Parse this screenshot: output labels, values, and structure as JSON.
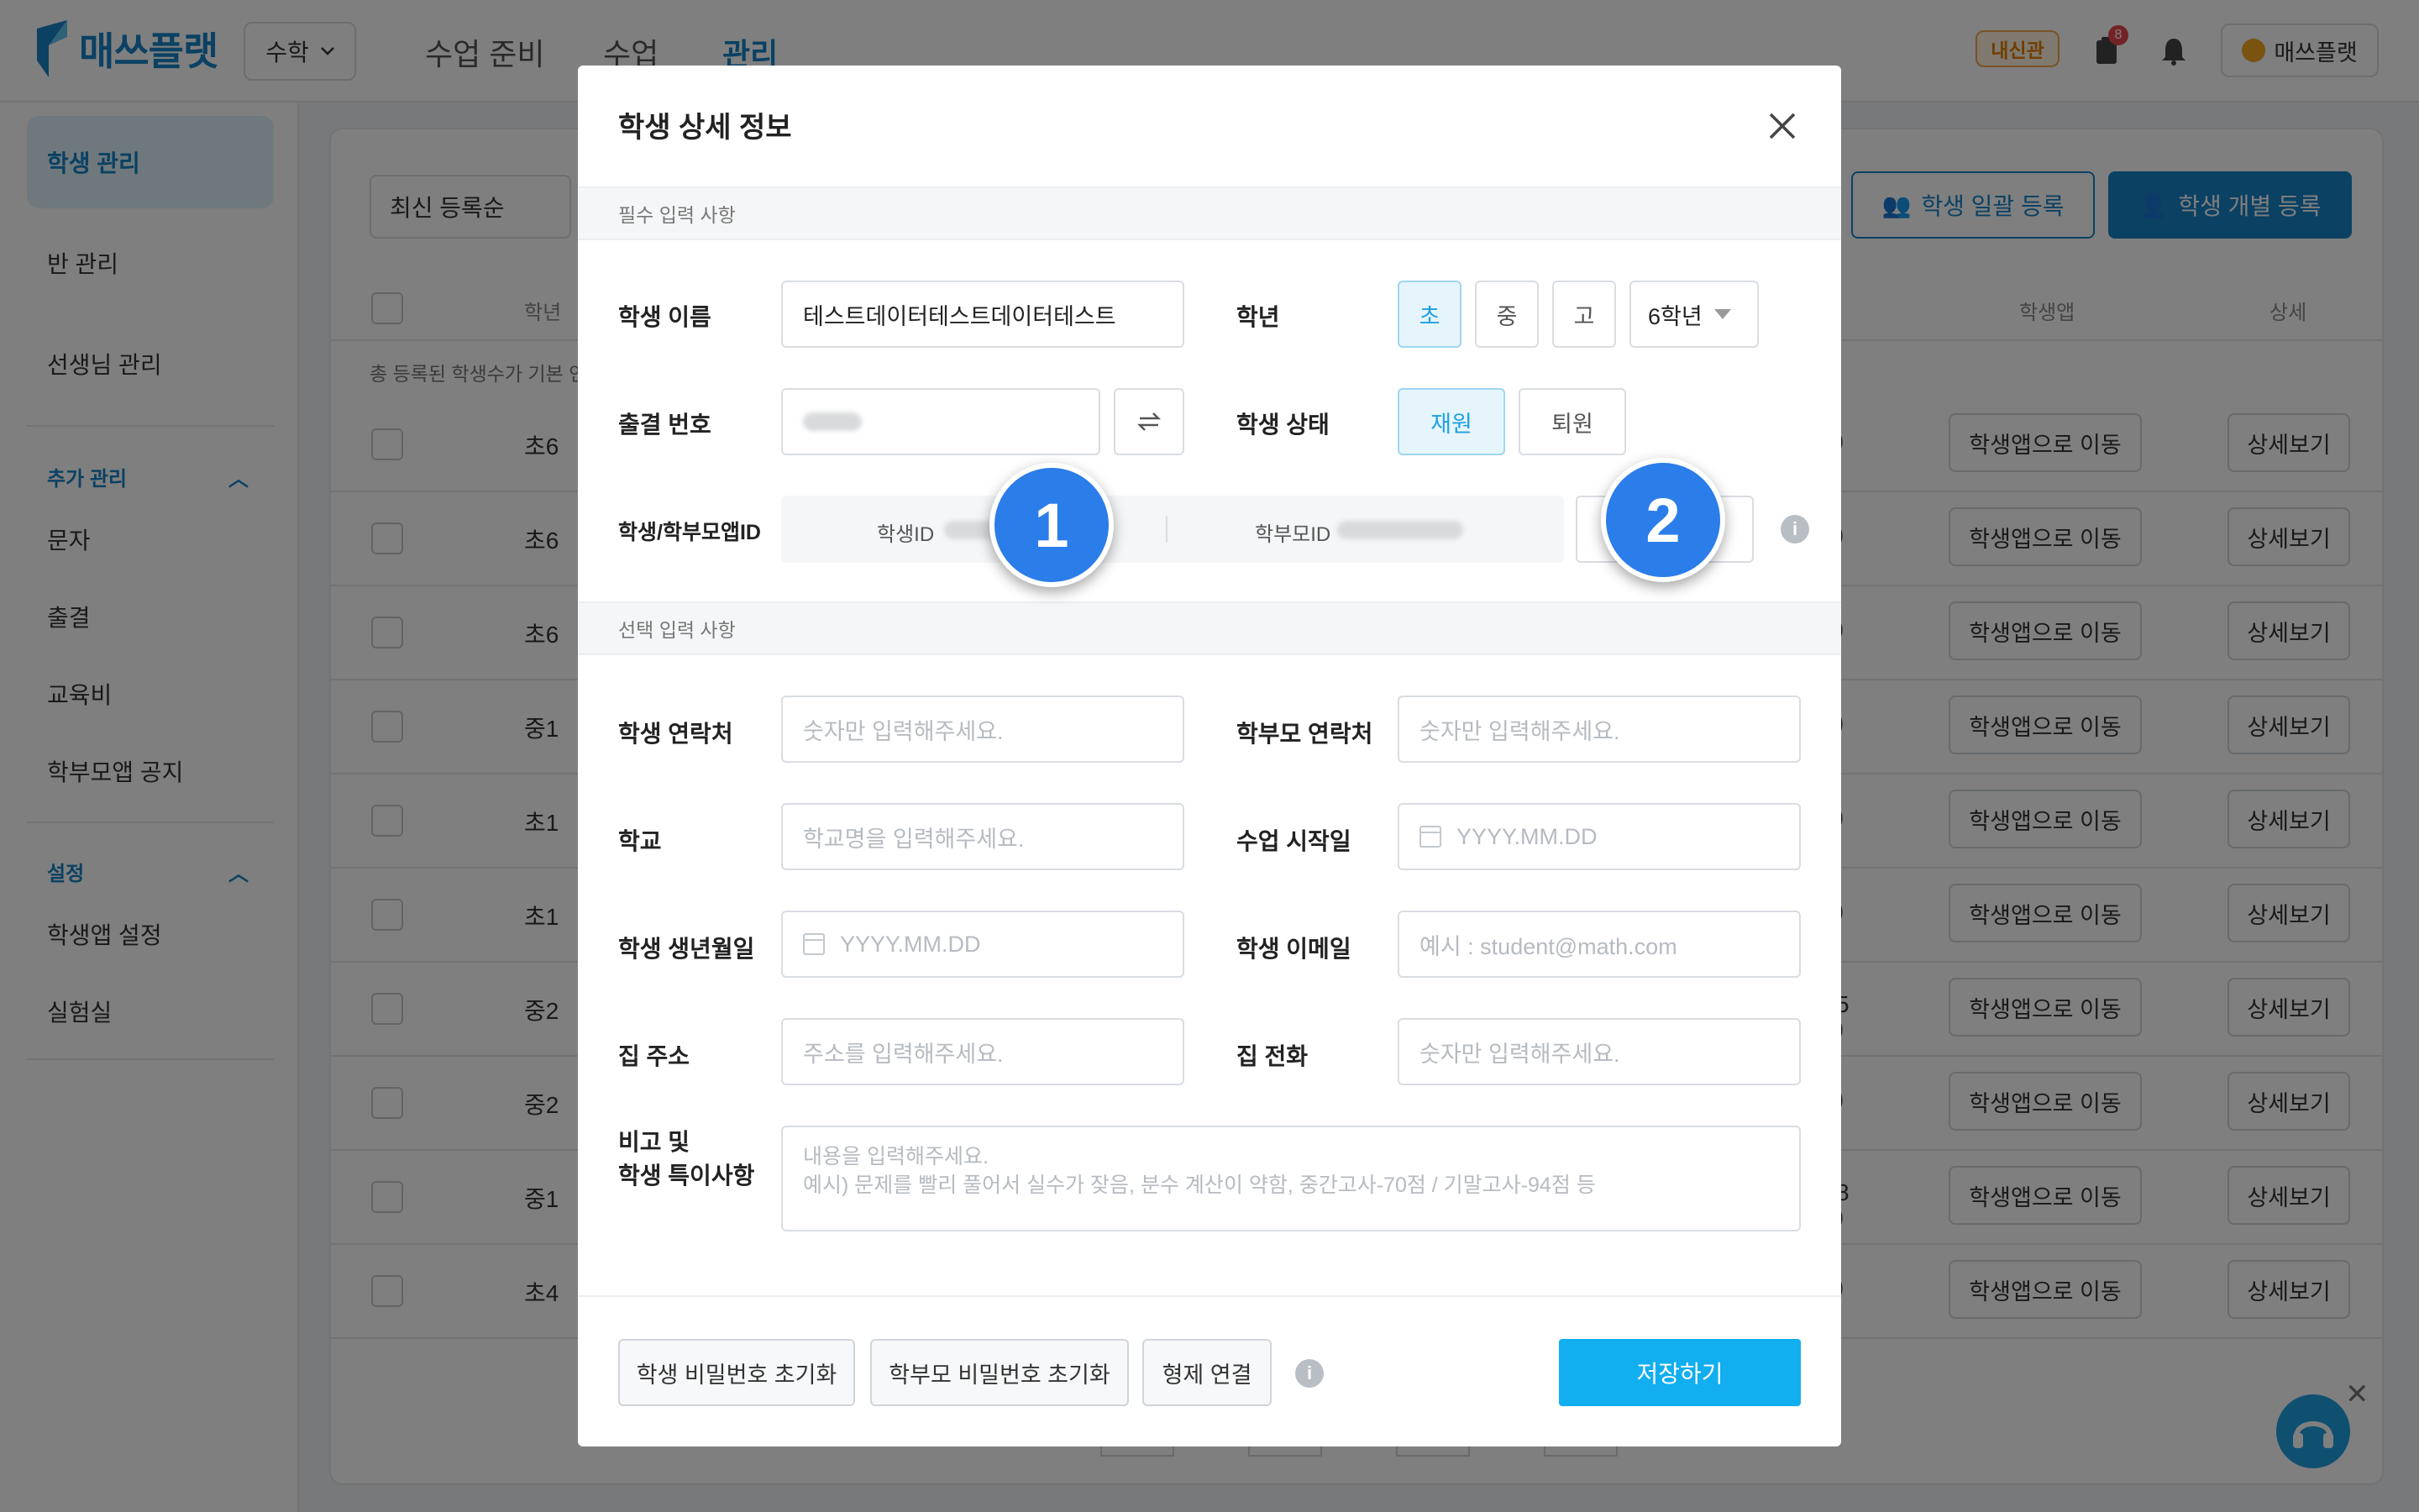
{
  "topbar": {
    "logo_text": "매쓰플랫",
    "subject": "수학",
    "nav": [
      "수업 준비",
      "수업",
      "관리"
    ],
    "active_nav": "관리",
    "badge": "내신관",
    "notif_count": "8",
    "user": "매쓰플랫"
  },
  "sidebar": {
    "items": [
      "학생 관리",
      "반 관리",
      "선생님 관리"
    ],
    "section1": "추가 관리",
    "section1_items": [
      "문자",
      "출결",
      "교육비",
      "학부모앱 공지"
    ],
    "section2": "설정",
    "section2_items": [
      "학생앱 설정",
      "실험실"
    ]
  },
  "list": {
    "sort": "최신 등록순",
    "bulk_register": "학생 일괄 등록",
    "single_register": "학생 개별 등록",
    "col_grade": "학년",
    "col_app": "학생앱",
    "col_detail": "상세",
    "info": "총 등록된 학생수가 기본 인",
    "rows": [
      {
        "grade": "초6",
        "paren": ")"
      },
      {
        "grade": "초6",
        "paren": ")"
      },
      {
        "grade": "초6",
        "paren": ")"
      },
      {
        "grade": "중1",
        "paren": ")"
      },
      {
        "grade": "초1",
        "paren": ")"
      },
      {
        "grade": "초1",
        "paren": ")"
      },
      {
        "grade": "중2",
        "paren": "5\n)"
      },
      {
        "grade": "중2",
        "paren": ")"
      },
      {
        "grade": "중1",
        "paren": "8\n)"
      },
      {
        "grade": "초4",
        "paren": ")"
      }
    ],
    "app_btn": "학생앱으로 이동",
    "detail_btn": "상세보기"
  },
  "modal": {
    "title": "학생 상세 정보",
    "required_section": "필수 입력 사항",
    "optional_section": "선택 입력 사항",
    "name_label": "학생 이름",
    "name_value": "테스트데이터테스트데이터테스트",
    "grade_label": "학년",
    "level_options": [
      "초",
      "중",
      "고"
    ],
    "grade_select": "6학년",
    "attendance_label": "출결 번호",
    "status_label": "학생 상태",
    "status_options": [
      "재원",
      "퇴원"
    ],
    "appid_label": "학생/학부모앱ID",
    "student_id_label": "학생ID",
    "parent_id_label": "학부모ID",
    "student_phone_label": "학생 연락처",
    "student_phone_ph": "숫자만 입력해주세요.",
    "parent_phone_label": "학부모 연락처",
    "parent_phone_ph": "숫자만 입력해주세요.",
    "school_label": "학교",
    "school_ph": "학교명을 입력해주세요.",
    "start_label": "수업 시작일",
    "date_ph": "YYYY.MM.DD",
    "birth_label": "학생 생년월일",
    "email_label": "학생 이메일",
    "email_ph": "예시 : student@math.com",
    "address_label": "집 주소",
    "address_ph": "주소를 입력해주세요.",
    "home_phone_label": "집 전화",
    "home_phone_ph": "숫자만 입력해주세요.",
    "note_label_1": "비고 및",
    "note_label_2": "학생 특이사항",
    "note_ph_1": "내용을 입력해주세요.",
    "note_ph_2": "예시) 문제를 빨리 풀어서 실수가 잦음, 분수 계산이 약함, 중간고사-70점 / 기말고사-94점 등",
    "reset_student_pw": "학생 비밀번호 초기화",
    "reset_parent_pw": "학부모 비밀번호 초기화",
    "sibling_link": "형제 연결",
    "save": "저장하기",
    "info_glyph": "i"
  },
  "steps": [
    "1",
    "2"
  ],
  "colors": {
    "brand": "#1782c6",
    "accent": "#11aef0",
    "step": "#2b7de9"
  }
}
